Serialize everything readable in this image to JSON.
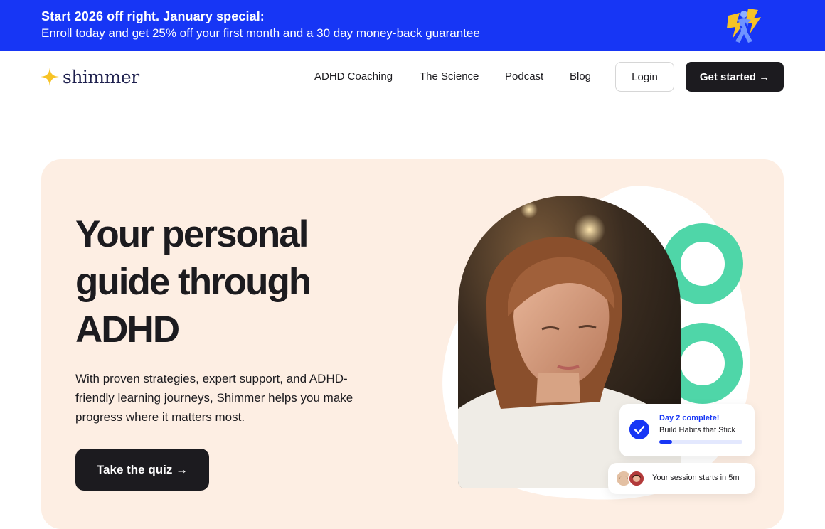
{
  "promo": {
    "title": "Start 2026 off right. January special:",
    "subtitle": "Enroll today and get 25% off your first month and a 30 day money-back guarantee",
    "art_icon": "celebrating-figure-lightning-icon"
  },
  "nav": {
    "logo_text": "shimmer",
    "links": [
      "ADHD Coaching",
      "The Science",
      "Podcast",
      "Blog"
    ],
    "login_label": "Login",
    "get_started_label": "Get started →"
  },
  "hero": {
    "title": "Your personal guide through ADHD",
    "description": "With proven strategies, expert support, and ADHD-friendly learning journeys, Shimmer helps you make progress where it matters most.",
    "cta_label": "Take the quiz →",
    "card_progress": {
      "title": "Day 2 complete!",
      "subtitle": "Build Habits that Stick",
      "progress_fraction": 0.15
    },
    "card_session": {
      "text": "Your session starts in 5m"
    }
  },
  "colors": {
    "brand_blue": "#1736f5",
    "dark": "#1c1b1f",
    "hero_bg": "#fdeee3",
    "accent_green": "#4fd6a8",
    "logo_yellow": "#f7c325"
  }
}
